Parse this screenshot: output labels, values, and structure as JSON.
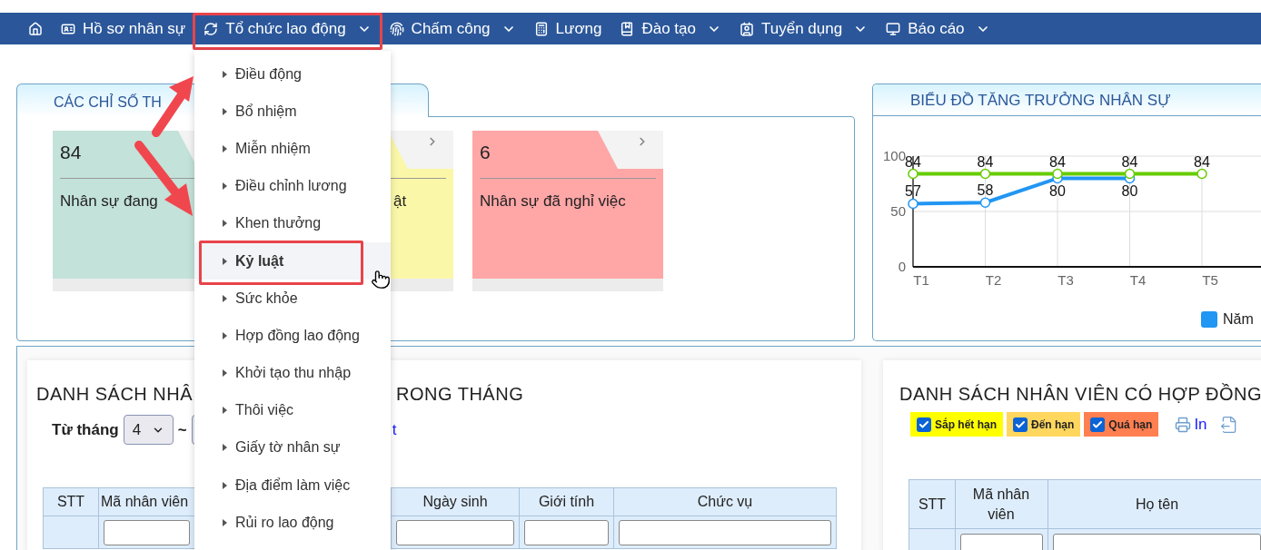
{
  "nav": [
    {
      "kind": "home",
      "has_menu": false,
      "callout": false
    },
    {
      "kind": "profile",
      "label": "Hồ sơ nhân sự",
      "has_menu": false,
      "callout": false
    },
    {
      "kind": "organization",
      "label": "Tổ chức lao động",
      "has_menu": true,
      "callout": true
    },
    {
      "kind": "attendance",
      "label": "Chấm công",
      "has_menu": true,
      "callout": false
    },
    {
      "kind": "salary",
      "label": "Lương",
      "has_menu": false,
      "callout": false
    },
    {
      "kind": "training",
      "label": "Đào tạo",
      "has_menu": true,
      "callout": false
    },
    {
      "kind": "recruiting",
      "label": "Tuyển dụng",
      "has_menu": true,
      "callout": false
    },
    {
      "kind": "reports",
      "label": "Báo cáo",
      "has_menu": true,
      "callout": false
    }
  ],
  "menu": [
    {
      "label": "Điều động",
      "selected": false,
      "callout": false
    },
    {
      "label": "Bổ nhiệm",
      "selected": false,
      "callout": false
    },
    {
      "label": "Miễn nhiệm",
      "selected": false,
      "callout": false
    },
    {
      "label": "Điều chỉnh lương",
      "selected": false,
      "callout": false
    },
    {
      "label": "Khen thưởng",
      "selected": false,
      "callout": false
    },
    {
      "label": "Kỷ luật",
      "selected": true,
      "callout": true
    },
    {
      "label": "Sức khỏe",
      "selected": false,
      "callout": false
    },
    {
      "label": "Hợp đồng lao động",
      "selected": false,
      "callout": false
    },
    {
      "label": "Khởi tạo thu nhập",
      "selected": false,
      "callout": false
    },
    {
      "label": "Thôi việc",
      "selected": false,
      "callout": false
    },
    {
      "label": "Giấy tờ nhân sự",
      "selected": false,
      "callout": false
    },
    {
      "label": "Địa điểm làm việc",
      "selected": false,
      "callout": false
    },
    {
      "label": "Rủi ro lao động",
      "selected": false,
      "callout": false
    }
  ],
  "kpi_panel": {
    "title": "CÁC CHỈ SỐ TH",
    "cards": [
      {
        "value": "84",
        "label": "Nhân sự đang",
        "color": "#c3e2d9"
      },
      {
        "label": "ật",
        "color": "#fbf7a8"
      },
      {
        "value": "6",
        "label": "Nhân sự đã nghỉ việc",
        "color": "#ffa6a6"
      }
    ]
  },
  "chart_panel": {
    "title": "BIỂU ĐỒ TĂNG TRƯỞNG NHÂN SỰ",
    "chart_data": {
      "type": "line",
      "data_labels": true,
      "categories": [
        "T1",
        "T2",
        "T3",
        "T4",
        "T5"
      ],
      "ylim": [
        0,
        100
      ],
      "yticks": [
        0,
        50,
        100
      ],
      "series": [
        {
          "name": "Năm",
          "color": "#2196f3",
          "marker": true,
          "values": [
            57,
            58,
            80,
            80,
            null
          ],
          "value_labels": [
            "57",
            "58",
            "80",
            "80",
            null
          ]
        },
        {
          "color": "#66cc00",
          "marker": true,
          "values": [
            84,
            84,
            84,
            84,
            84
          ],
          "value_labels": [
            "84",
            "84",
            "84",
            "84",
            "84"
          ]
        }
      ]
    }
  },
  "left_list": {
    "title_start": "DANH SÁCH NHÂ",
    "title_end": "RONG THÁNG",
    "from_label": "Từ tháng",
    "from_value": "4",
    "separator": "~",
    "link": "t",
    "columns": [
      "STT",
      "Mã nhân viên",
      "Ngày sinh",
      "Giới tính",
      "Chức vụ"
    ]
  },
  "right_list": {
    "title": "DANH SÁCH NHÂN VIÊN CÓ HỢP ĐỒNG",
    "filters": [
      {
        "label": "Sắp hết hạn",
        "checked": true,
        "color": "#ffff00"
      },
      {
        "label": "Đến hạn",
        "checked": true,
        "color": "#ffd75e"
      },
      {
        "label": "Quá hạn",
        "checked": true,
        "color": "#ff7f50"
      }
    ],
    "print": "In",
    "columns": [
      "STT",
      "Mã nhân viên",
      "Họ tên"
    ]
  }
}
